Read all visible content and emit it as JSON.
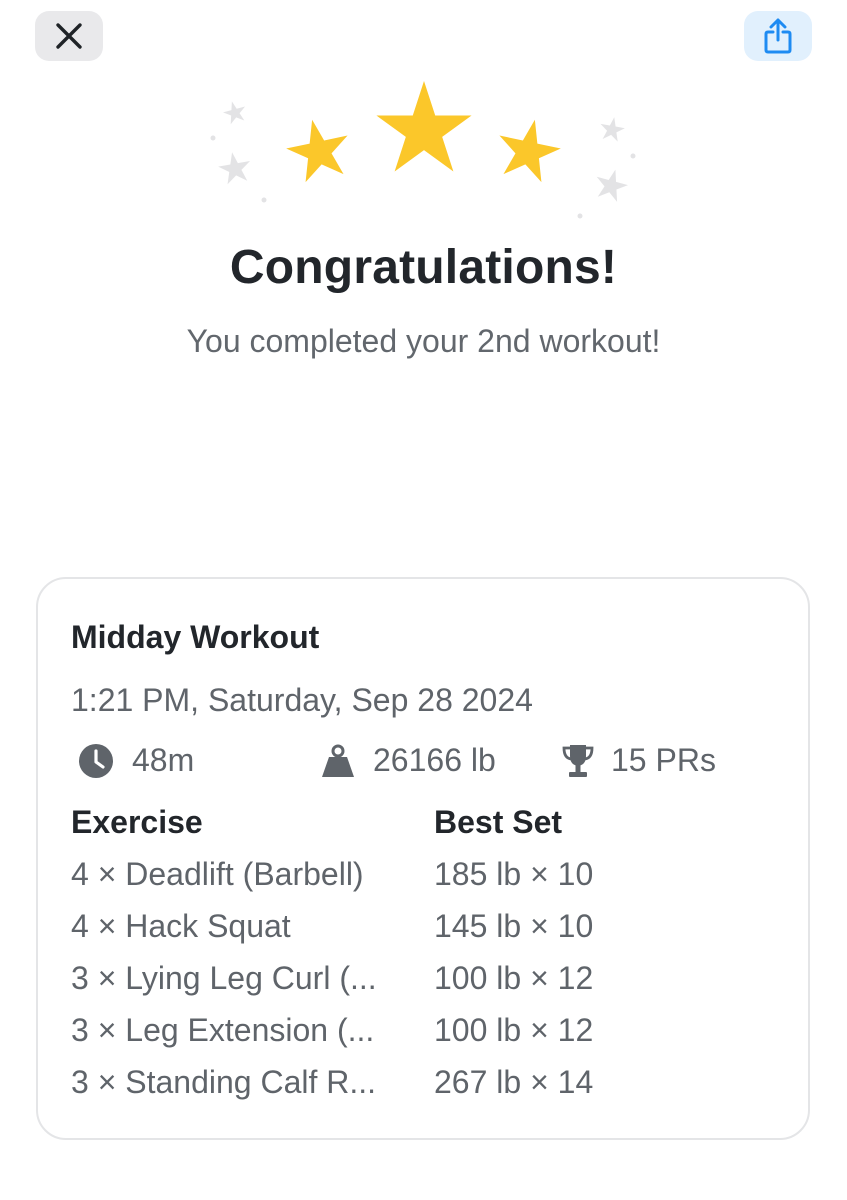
{
  "header": {
    "close_icon": "close-x-icon",
    "share_icon": "share-upload-icon",
    "share_color": "#1e8bf2"
  },
  "celebration": {
    "star_color": "#fbc72a",
    "sparkle_color": "#e3e3e5"
  },
  "title": "Congratulations!",
  "subtitle": "You completed your 2nd workout!",
  "workout": {
    "name": "Midday Workout",
    "datetime": "1:21 PM, Saturday, Sep 28 2024",
    "duration": "48m",
    "volume": "26166 lb",
    "prs": "15 PRs",
    "columns": {
      "exercise": "Exercise",
      "best_set": "Best Set"
    },
    "exercises": [
      {
        "name": "4 × Deadlift (Barbell)",
        "best_set": "185 lb × 10"
      },
      {
        "name": "4 × Hack Squat",
        "best_set": "145 lb × 10"
      },
      {
        "name": "3 × Lying Leg Curl (...",
        "best_set": "100 lb × 12"
      },
      {
        "name": "3 × Leg Extension (...",
        "best_set": "100 lb × 12"
      },
      {
        "name": "3 × Standing Calf R...",
        "best_set": "267 lb × 14"
      }
    ]
  }
}
